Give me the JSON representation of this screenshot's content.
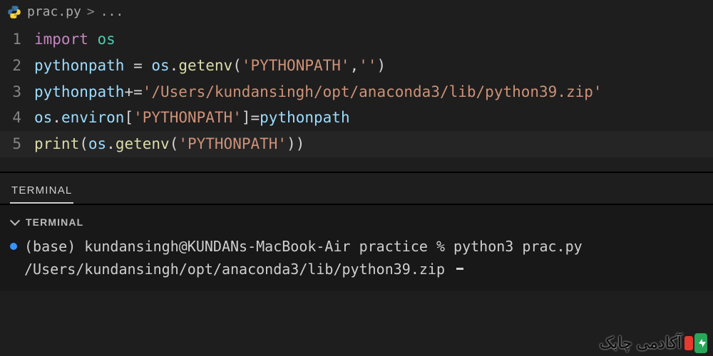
{
  "breadcrumb": {
    "filename": "prac.py",
    "separator": ">",
    "tail": "..."
  },
  "code": {
    "lines": [
      {
        "n": "1",
        "tokens": [
          {
            "t": "import ",
            "c": "kw"
          },
          {
            "t": "os",
            "c": "mod"
          }
        ]
      },
      {
        "n": "2",
        "tokens": [
          {
            "t": "pythonpath ",
            "c": "ident"
          },
          {
            "t": "= ",
            "c": "op"
          },
          {
            "t": "os",
            "c": "ident"
          },
          {
            "t": ".",
            "c": "punc"
          },
          {
            "t": "getenv",
            "c": "fn"
          },
          {
            "t": "(",
            "c": "punc"
          },
          {
            "t": "'PYTHONPATH'",
            "c": "str"
          },
          {
            "t": ",",
            "c": "punc"
          },
          {
            "t": "''",
            "c": "str"
          },
          {
            "t": ")",
            "c": "punc"
          }
        ]
      },
      {
        "n": "3",
        "tokens": [
          {
            "t": "pythonpath",
            "c": "ident"
          },
          {
            "t": "+=",
            "c": "op"
          },
          {
            "t": "'/Users/kundansingh/opt/anaconda3/lib/python39.zip'",
            "c": "str"
          }
        ]
      },
      {
        "n": "4",
        "tokens": [
          {
            "t": "os",
            "c": "ident"
          },
          {
            "t": ".",
            "c": "punc"
          },
          {
            "t": "environ",
            "c": "const"
          },
          {
            "t": "[",
            "c": "punc"
          },
          {
            "t": "'PYTHONPATH'",
            "c": "str"
          },
          {
            "t": "]",
            "c": "punc"
          },
          {
            "t": "=",
            "c": "op"
          },
          {
            "t": "pythonpath",
            "c": "ident"
          }
        ]
      },
      {
        "n": "5",
        "tokens": [
          {
            "t": "print",
            "c": "fn"
          },
          {
            "t": "(",
            "c": "punc"
          },
          {
            "t": "os",
            "c": "ident"
          },
          {
            "t": ".",
            "c": "punc"
          },
          {
            "t": "getenv",
            "c": "fn"
          },
          {
            "t": "(",
            "c": "punc"
          },
          {
            "t": "'PYTHONPATH'",
            "c": "str"
          },
          {
            "t": ")",
            "c": "punc"
          },
          {
            "t": ")",
            "c": "punc"
          }
        ]
      }
    ],
    "active_line": 5
  },
  "panel": {
    "tab": "TERMINAL",
    "header": "TERMINAL",
    "lines": [
      "(base) kundansingh@KUNDANs-MacBook-Air practice % python3 prac.py",
      "/Users/kundansingh/opt/anaconda3/lib/python39.zip"
    ]
  },
  "watermark": {
    "text": "آکادمی چابک"
  }
}
